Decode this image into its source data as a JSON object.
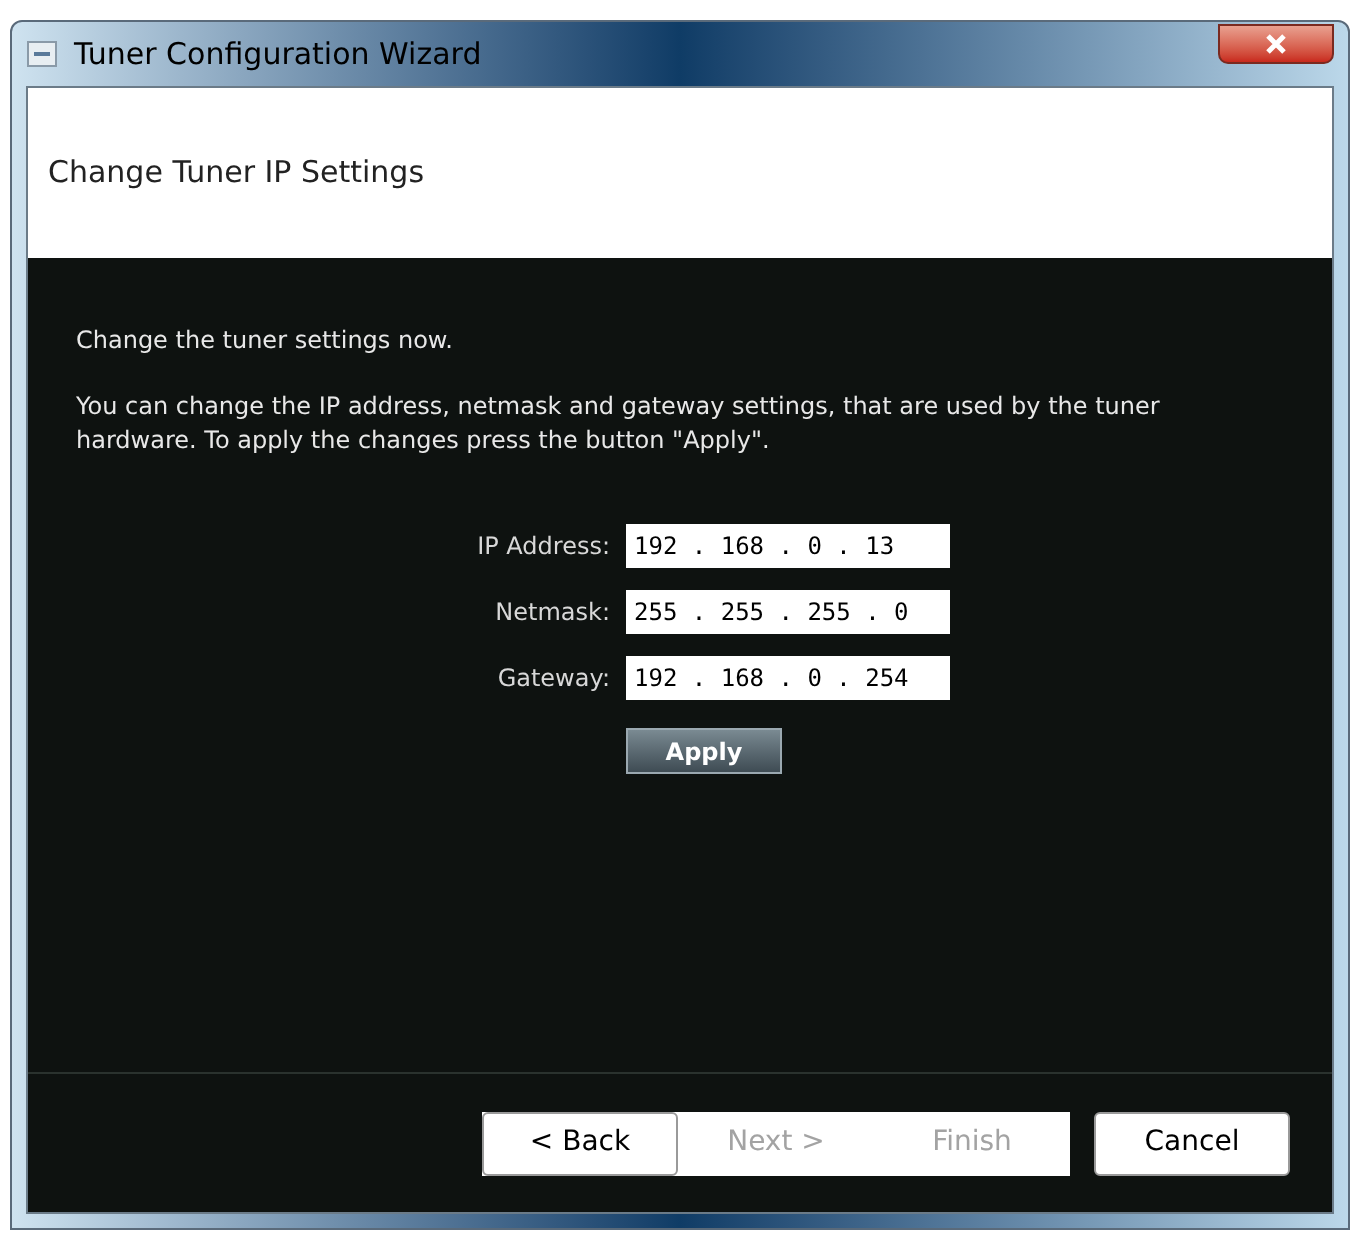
{
  "window": {
    "title": "Tuner Configuration Wizard"
  },
  "header": {
    "title": "Change Tuner IP Settings"
  },
  "body": {
    "intro": "Change the tuner settings now.",
    "description": "You can change the IP address, netmask and gateway settings, that are used by the tuner hardware. To apply the changes press the button \"Apply\"."
  },
  "fields": [
    {
      "label": "IP Address:",
      "value": "192 . 168 . 0 . 13"
    },
    {
      "label": "Netmask:",
      "value": "255 . 255 . 255 . 0"
    },
    {
      "label": "Gateway:",
      "value": "192 . 168 . 0 . 254"
    }
  ],
  "apply_button": "Apply",
  "buttons": [
    {
      "label": "< Back",
      "disabled": false
    },
    {
      "label": "Next >",
      "disabled": true
    },
    {
      "label": "Finish",
      "disabled": true
    },
    {
      "label": "Cancel",
      "disabled": false
    }
  ]
}
